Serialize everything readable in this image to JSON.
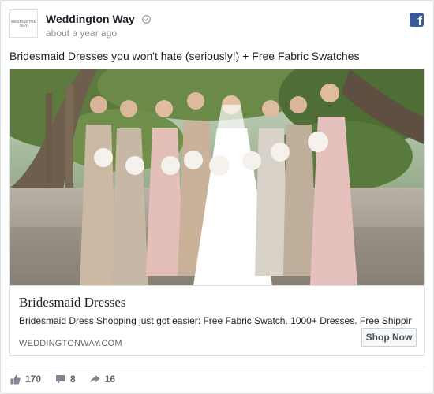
{
  "post": {
    "page_name": "Weddington Way",
    "avatar_text": "WEDDINGTON WAY",
    "timestamp": "about a year ago",
    "text": "Bridesmaid Dresses you won't hate (seriously!) + Free Fabric Swatches"
  },
  "ad": {
    "title": "Bridesmaid Dresses",
    "description": "Bridesmaid Dress Shopping just got easier: Free Fabric Swatch. 1000+ Dresses. Free Shipping & Fr...",
    "domain": "WEDDINGTONWAY.COM",
    "cta_label": "Shop Now"
  },
  "stats": {
    "likes": "170",
    "comments": "8",
    "shares": "16"
  },
  "colors": {
    "facebook_blue": "#3b5998",
    "meta_gray": "#90949c"
  }
}
